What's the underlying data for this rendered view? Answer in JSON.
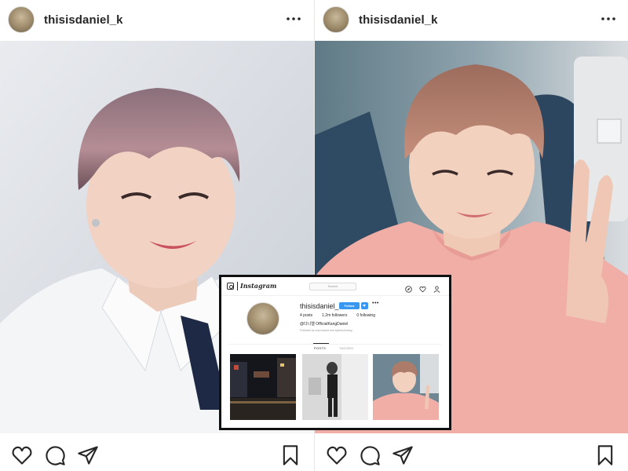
{
  "posts": [
    {
      "username": "thisisdaniel_k",
      "more_icon": "more-horizontal-icon",
      "actions": [
        "heart-icon",
        "comment-icon",
        "share-icon",
        "bookmark-icon"
      ]
    },
    {
      "username": "thisisdaniel_k",
      "more_icon": "more-horizontal-icon",
      "actions": [
        "heart-icon",
        "comment-icon",
        "share-icon",
        "bookmark-icon"
      ]
    }
  ],
  "inset_profile": {
    "wordmark": "Instagram",
    "search_placeholder": "Search",
    "username": "thisisdaniel_k",
    "follow_label": "Follow",
    "stats": {
      "posts": "4 posts",
      "followers": "1.2m followers",
      "following": "0 following"
    },
    "bio": "@다니엘 OfficialKangDaniel",
    "followed_by": "Followed by aud.mariaa and kylelmuhuang",
    "tabs": {
      "posts": "POSTS",
      "tagged": "TAGGED"
    }
  },
  "colors": {
    "text": "#262626",
    "follow_button": "#3897f0",
    "divider": "#efefef",
    "inset_border": "#111111"
  }
}
